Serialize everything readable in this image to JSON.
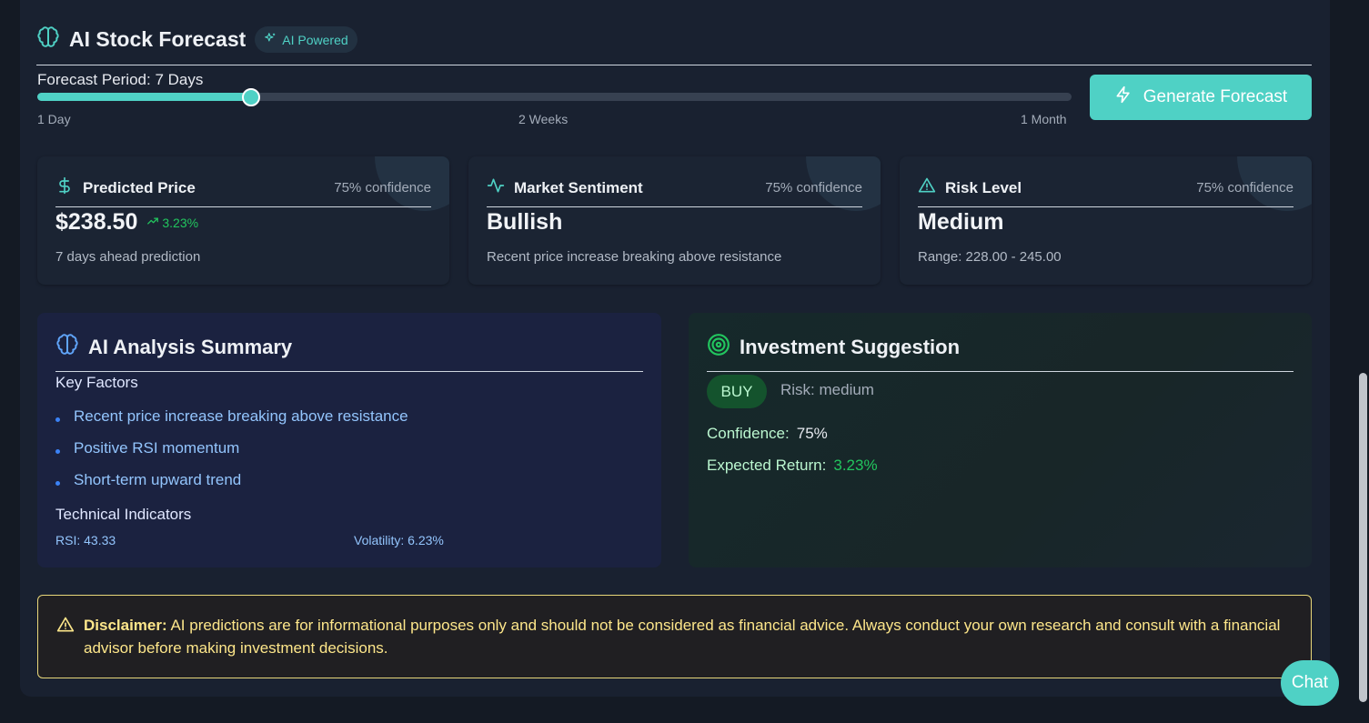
{
  "header": {
    "title": "AI Stock Forecast",
    "badge": "AI Powered"
  },
  "forecast": {
    "period_label": "Forecast Period: 7 Days",
    "slider_fraction": 0.207,
    "ticks": [
      "1 Day",
      "2 Weeks",
      "1 Month"
    ],
    "generate_label": "Generate Forecast"
  },
  "cards": [
    {
      "label": "Predicted Price",
      "confidence": "75% confidence",
      "value": "$238.50",
      "change": "3.23%",
      "sub": "7 days ahead prediction"
    },
    {
      "label": "Market Sentiment",
      "confidence": "75% confidence",
      "value": "Bullish",
      "sub": "Recent price increase breaking above resistance"
    },
    {
      "label": "Risk Level",
      "confidence": "75% confidence",
      "value": "Medium",
      "sub": "Range: 228.00 - 245.00"
    }
  ],
  "analysis": {
    "title": "AI Analysis Summary",
    "key_factors_title": "Key Factors",
    "key_factors": [
      "Recent price increase breaking above resistance",
      "Positive RSI momentum",
      "Short-term upward trend"
    ],
    "technical_title": "Technical Indicators",
    "rsi": "RSI: 43.33",
    "volatility": "Volatility: 6.23%"
  },
  "suggestion": {
    "title": "Investment Suggestion",
    "action": "BUY",
    "risk": "Risk: medium",
    "confidence_label": "Confidence:",
    "confidence_value": "75%",
    "return_label": "Expected Return:",
    "return_value": "3.23%"
  },
  "disclaimer": {
    "label": "Disclaimer:",
    "text": "AI predictions are for informational purposes only and should not be considered as financial advice. Always conduct your own research and consult with a financial advisor before making investment decisions."
  },
  "chat": {
    "label": "Chat"
  },
  "colors": {
    "accent": "#4fd1c5",
    "positive": "#22c55e",
    "warning": "#fde68a"
  }
}
